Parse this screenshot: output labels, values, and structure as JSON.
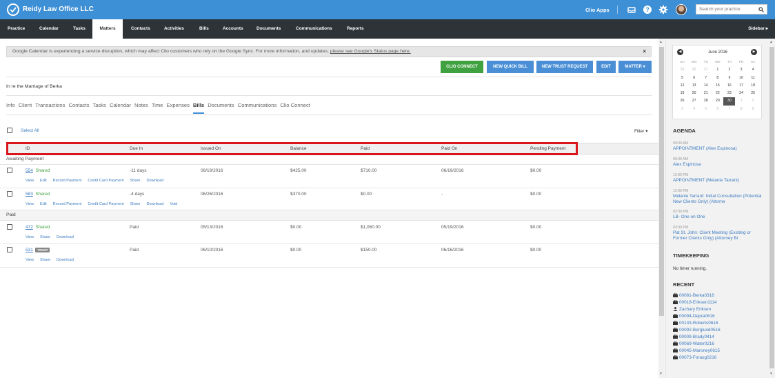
{
  "app": {
    "brand": "Reidy Law Office LLC",
    "clio_apps": "Clio Apps",
    "search_placeholder": "Search your practice"
  },
  "nav": {
    "items": [
      "Practice",
      "Calendar",
      "Tasks",
      "Matters",
      "Contacts",
      "Activities",
      "Bills",
      "Accounts",
      "Documents",
      "Communications",
      "Reports"
    ],
    "active": "Matters",
    "sidebar_toggle": "Sidebar ▸"
  },
  "alert": {
    "text": "Google Calendar is experiencing a service disruption, which may affect Clio customers who rely on the Google Sync. For more information, and updates,",
    "link": "please see Google's Status page here.",
    "close": "×"
  },
  "actions": {
    "clio_connect": "CLIO CONNECT",
    "new_quick_bill": "NEW QUICK BILL",
    "new_trust_request": "NEW TRUST REQUEST",
    "edit": "EDIT",
    "matter": "MATTER ▾"
  },
  "matter_title": "In re the Marriage of Berka",
  "tabs": [
    "Info",
    "Client",
    "Transactions",
    "Contacts",
    "Tasks",
    "Calendar",
    "Notes",
    "Time",
    "Expenses",
    "Bills",
    "Documents",
    "Communications",
    "Clio Connect"
  ],
  "active_tab": "Bills",
  "list": {
    "select_all": "Select All",
    "filter": "Filter ▾",
    "columns": [
      "ID",
      "Due In",
      "Issued On",
      "Balance",
      "Paid",
      "Paid On",
      "Pending Payment"
    ],
    "groups": {
      "awaiting": "Awaiting Payment",
      "paid": "Paid"
    },
    "rows": [
      {
        "id": "554",
        "status": "Shared",
        "due_in": "-11 days",
        "issued_on": "06/19/2016",
        "balance": "$425.00",
        "paid": "$710.00",
        "paid_on": "06/19/2016",
        "pending": "$0.00",
        "actions": [
          "View",
          "Edit",
          "Record Payment",
          "Credit Card Payment",
          "Share",
          "Download"
        ]
      },
      {
        "id": "583",
        "status": "Shared",
        "due_in": "-4 days",
        "issued_on": "06/26/2016",
        "balance": "$370.00",
        "paid": "$0.00",
        "paid_on": "-",
        "pending": "$0.00",
        "actions": [
          "View",
          "Edit",
          "Record Payment",
          "Credit Card Payment",
          "Share",
          "Download",
          "Void"
        ]
      },
      {
        "id": "472",
        "status": "Shared",
        "due_in": "Paid",
        "issued_on": "05/13/2016",
        "balance": "$0.00",
        "paid": "$1,060.00",
        "paid_on": "05/19/2016",
        "pending": "$0.00",
        "actions": [
          "View",
          "Share",
          "Download"
        ]
      },
      {
        "id": "531",
        "status": "TRUST",
        "due_in": "Paid",
        "issued_on": "06/10/2016",
        "balance": "$0.00",
        "paid": "$150.00",
        "paid_on": "06/16/2016",
        "pending": "$0.00",
        "actions": [
          "View",
          "Share",
          "Download"
        ]
      }
    ]
  },
  "calendar": {
    "title": "June 2016",
    "weekdays": [
      "SU",
      "MO",
      "TU",
      "WE",
      "TH",
      "FR",
      "SA"
    ],
    "weeks": [
      [
        "29",
        "30",
        "31",
        "1",
        "2",
        "3",
        "4"
      ],
      [
        "5",
        "6",
        "7",
        "8",
        "9",
        "10",
        "11"
      ],
      [
        "12",
        "13",
        "14",
        "15",
        "16",
        "17",
        "18"
      ],
      [
        "19",
        "20",
        "21",
        "22",
        "23",
        "24",
        "25"
      ],
      [
        "26",
        "27",
        "28",
        "29",
        "30",
        "1",
        "2"
      ],
      [
        "3",
        "4",
        "5",
        "6",
        "7",
        "8",
        "9"
      ]
    ],
    "today": "30"
  },
  "agenda": {
    "heading": "AGENDA",
    "items": [
      {
        "time": "09:00 AM",
        "text": "APPOINTMENT (Alex Espinosa)"
      },
      {
        "time": "09:00 AM",
        "text": "Alex Espinosa"
      },
      {
        "time": "12:00 PM",
        "text": "APPOINTMENT (Melanie Tarrant)"
      },
      {
        "time": "12:00 PM",
        "text": "Melanie Tarrant: Initial Consultation (Potential New Clients Only) (Attorne"
      },
      {
        "time": "02:00 PM",
        "text": "LB- One on One"
      },
      {
        "time": "03:30 PM",
        "text": "Pat St. John: Client Meeting (Existing or Former Clients Only) (Attorney Br"
      }
    ]
  },
  "timekeeping": {
    "heading": "TIMEKEEPING",
    "text": "No timer running."
  },
  "recent": {
    "heading": "RECENT",
    "items": [
      {
        "icon": "briefcase-icon",
        "label": "00081-Berka0316"
      },
      {
        "icon": "briefcase-icon",
        "label": "00018-Eriksen1114"
      },
      {
        "icon": "person-icon",
        "label": "Zachary Eriksen"
      },
      {
        "icon": "briefcase-icon",
        "label": "00094-Depra0616"
      },
      {
        "icon": "briefcase-icon",
        "label": "00133-Roberts0616"
      },
      {
        "icon": "briefcase-icon",
        "label": "00092-Berglund0516"
      },
      {
        "icon": "briefcase-icon",
        "label": "00009-Brady0414"
      },
      {
        "icon": "briefcase-icon",
        "label": "00069-Water0216"
      },
      {
        "icon": "briefcase-icon",
        "label": "00045-Maroney0615"
      },
      {
        "icon": "briefcase-icon",
        "label": "00073-Foraug0216"
      }
    ]
  },
  "colors": {
    "topbar": "#3d8fd6",
    "navbar": "#2e3338",
    "green": "#3fa13f",
    "blue": "#4a8fd6",
    "highlight": "#d9161c"
  }
}
